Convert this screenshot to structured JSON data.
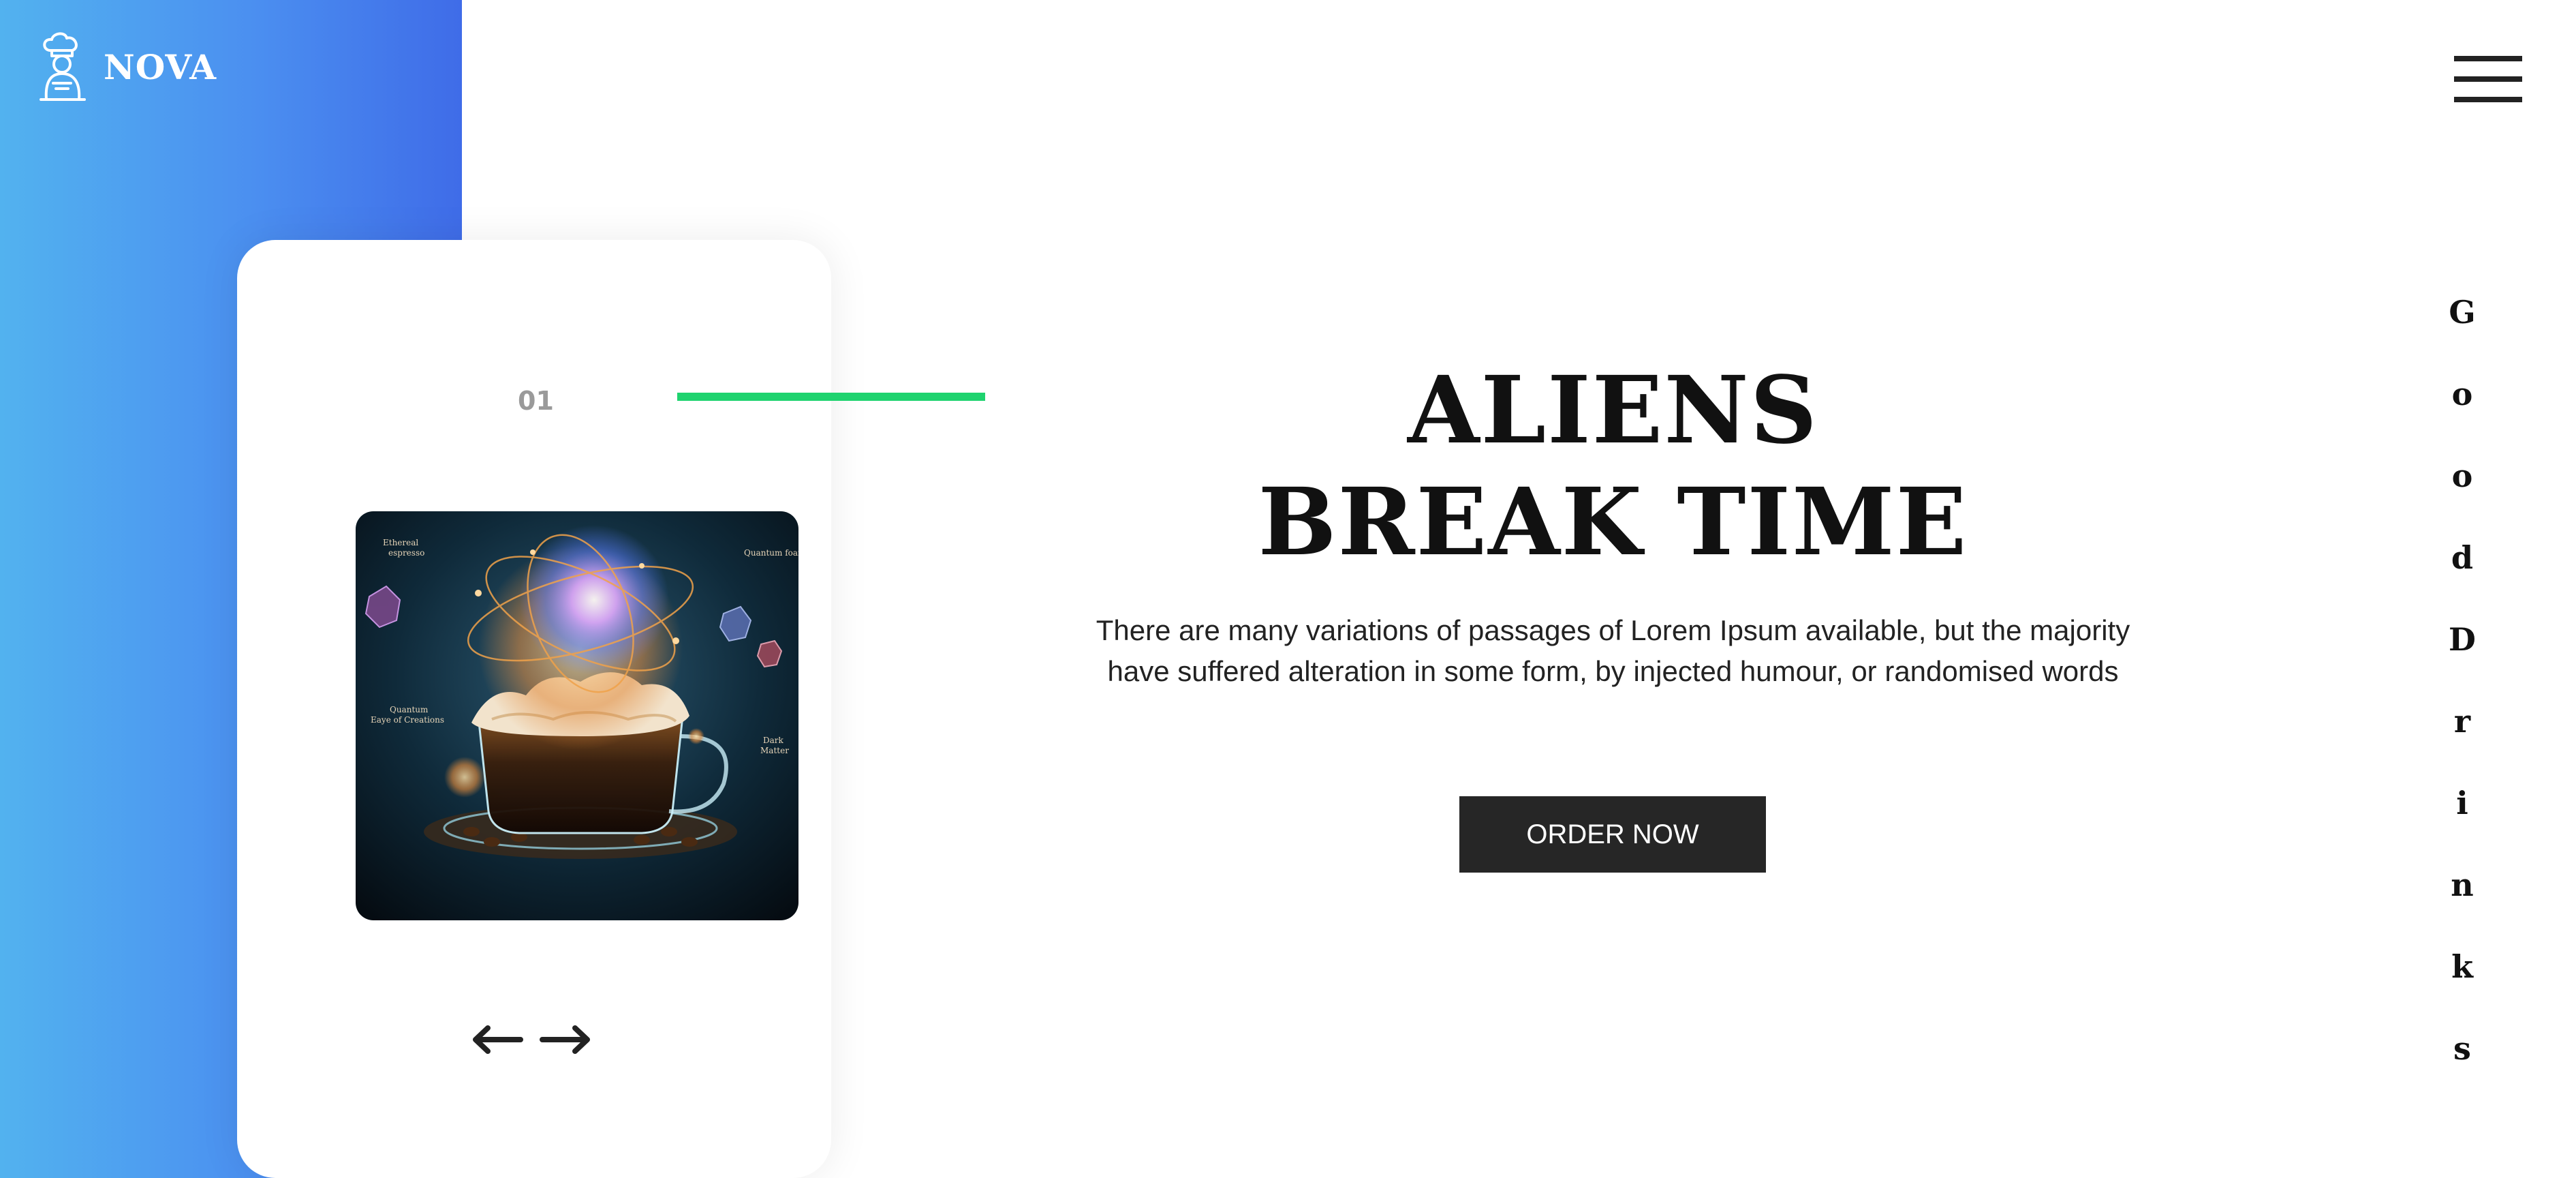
{
  "brand": {
    "name": "NOVA",
    "icon": "chef-icon"
  },
  "menu": {
    "icon": "hamburger-menu-icon"
  },
  "slider": {
    "number": "01",
    "image_label": "cosmic-coffee-image",
    "image_captions": [
      "Ethereal espresso",
      "Quantum foam",
      "Quantum Eaye of Creations",
      "Dark Matter"
    ],
    "prev_icon": "arrow-left-icon",
    "next_icon": "arrow-right-icon"
  },
  "hero": {
    "title_line1": "ALIENS",
    "title_line2": "BREAK TIME",
    "description": "There are many variations of passages of Lorem Ipsum available, but the majority have suffered alteration in some form, by injected humour, or randomised words",
    "cta_label": "ORDER NOW"
  },
  "side_text": {
    "letters": [
      "G",
      "o",
      "o",
      "d",
      "D",
      "r",
      "i",
      "n",
      "k",
      "s"
    ]
  },
  "colors": {
    "gradient_start": "#52b2ef",
    "gradient_end": "#3f6ce8",
    "accent_green": "#1fd36f",
    "button_dark": "#262626"
  }
}
